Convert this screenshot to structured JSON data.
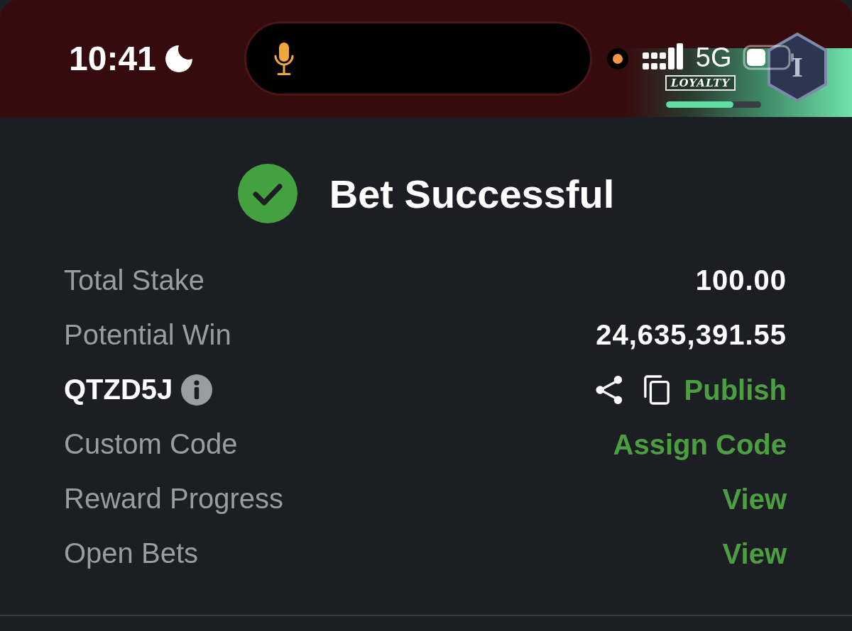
{
  "status_bar": {
    "time": "10:41",
    "network": "5G"
  },
  "loyalty": {
    "label": "LOYALTY",
    "level": 0.71,
    "rank": "I"
  },
  "header": {
    "title": "Bet Successful"
  },
  "rows": [
    {
      "kind": "value",
      "label": "Total Stake",
      "value": "100.00"
    },
    {
      "kind": "value",
      "label": "Potential Win",
      "value": "24,635,391.55"
    },
    {
      "kind": "code",
      "label": "QTZD5J",
      "action": "Publish"
    },
    {
      "kind": "link",
      "label": "Custom Code",
      "action": "Assign Code"
    },
    {
      "kind": "link",
      "label": "Reward Progress",
      "action": "View"
    },
    {
      "kind": "link",
      "label": "Open Bets",
      "action": "View"
    }
  ]
}
